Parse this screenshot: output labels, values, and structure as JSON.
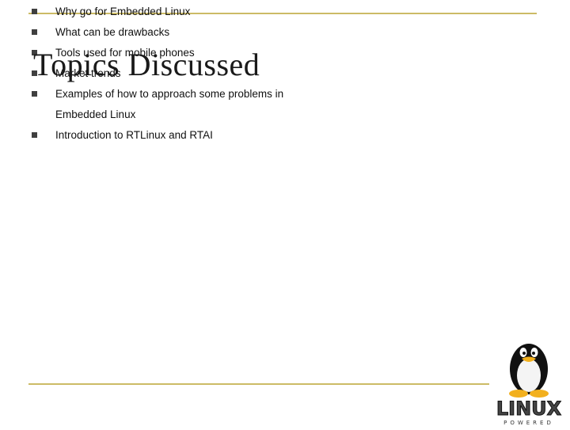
{
  "slide": {
    "title": "Topics Discussed",
    "bullets": [
      "Why go for Embedded Linux",
      "What can be drawbacks",
      "Tools used for mobile phones",
      "Market trends",
      "Examples of how to approach some problems in",
      "Introduction to RTLinux and RTAI"
    ],
    "bullet_continuation": "Embedded Linux"
  },
  "logo": {
    "name": "LINUX",
    "tagline": "POWERED",
    "icon": "tux-penguin-icon"
  },
  "colors": {
    "rule": "#ccbb66",
    "bullet": "#3f3f3f",
    "logo_accent": "#c8102e"
  }
}
